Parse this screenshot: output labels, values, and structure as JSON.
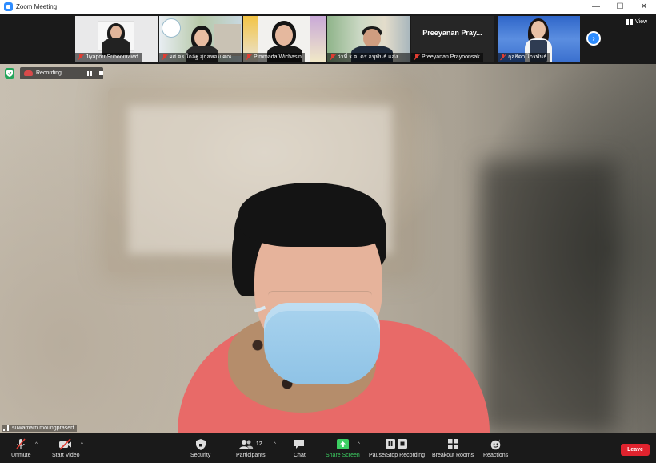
{
  "window": {
    "title": "Zoom Meeting",
    "minimize_icon": "—",
    "maximize_icon": "☐",
    "close_icon": "✕"
  },
  "gallery": {
    "participants": [
      {
        "name": "JiyapornSriboonrawd",
        "muted": true,
        "video": true
      },
      {
        "name": "ผศ.ดร.ใกล้ฐ สุกุลหอม คณะศ...",
        "muted": true,
        "video": true
      },
      {
        "name": "Pimmada Wichasin",
        "muted": true,
        "video": true
      },
      {
        "name": "ว่าที่ ร.ต. ดร.อนุพันธ์ แสงรุ่ง...",
        "muted": true,
        "video": true
      },
      {
        "name": "Preeyanan Prayoonsak",
        "big_name": "Preeyanan  Pray...",
        "muted": true,
        "video": false
      },
      {
        "name": "กุลธิดา  ไกรพันธ์",
        "muted": true,
        "video": true
      }
    ],
    "next_icon": "›",
    "view_label": "View"
  },
  "main_video": {
    "speaker_name": "suwamarn moungprasert",
    "recording_label": "Recording..."
  },
  "toolbar": {
    "unmute_label": "Unmute",
    "start_video_label": "Start Video",
    "security_label": "Security",
    "participants_label": "Participants",
    "participants_count": "12",
    "chat_label": "Chat",
    "share_screen_label": "Share Screen",
    "recording_label": "Pause/Stop Recording",
    "breakout_label": "Breakout Rooms",
    "reactions_label": "Reactions",
    "leave_label": "Leave",
    "caret": "^"
  },
  "colors": {
    "accent": "#2d8cff",
    "share_green": "#3ccf62",
    "leave_red": "#e0232e",
    "muted_red": "#e03c31",
    "security_green": "#23a55a"
  }
}
